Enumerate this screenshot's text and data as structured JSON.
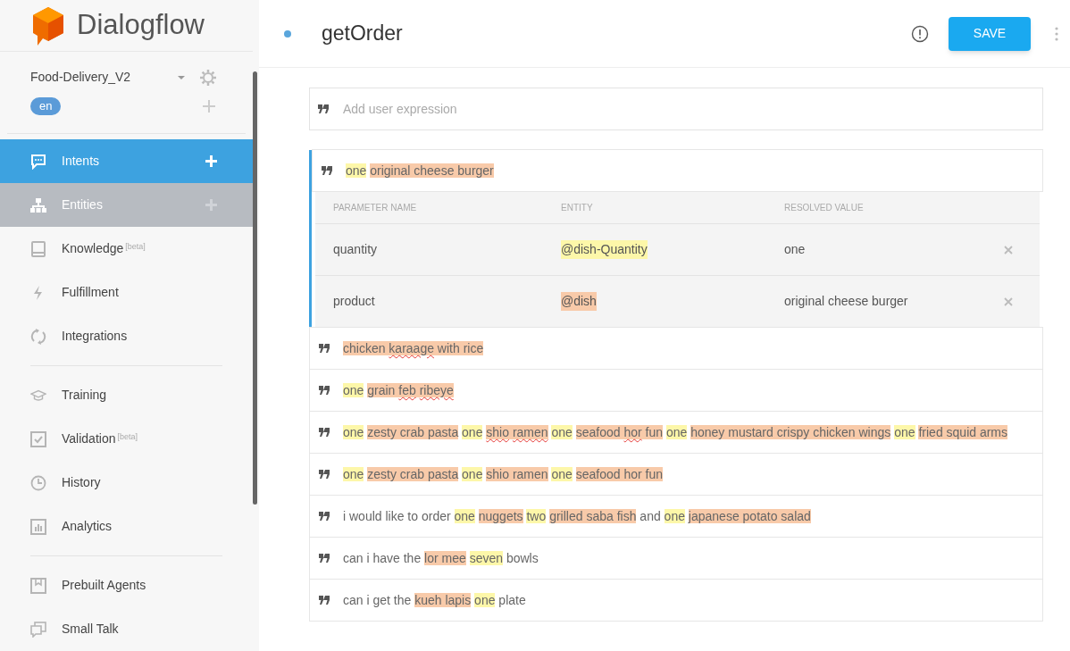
{
  "logo": {
    "name": "Dialogflow"
  },
  "agent": {
    "name": "Food-Delivery_V2",
    "language": "en"
  },
  "sidebar": {
    "sections": [
      {
        "items": [
          {
            "kind": "intents",
            "label": "Intents",
            "selected": true,
            "hovered": false,
            "add_button": true
          },
          {
            "kind": "entities",
            "label": "Entities",
            "selected": false,
            "hovered": true,
            "add_button": true
          },
          {
            "kind": "knowledge",
            "label": "Knowledge",
            "badge": "[beta]",
            "selected": false,
            "hovered": false,
            "add_button": false
          },
          {
            "kind": "fulfillment",
            "label": "Fulfillment",
            "selected": false,
            "hovered": false,
            "add_button": false
          },
          {
            "kind": "integrations",
            "label": "Integrations",
            "selected": false,
            "hovered": false,
            "add_button": false
          }
        ]
      },
      {
        "items": [
          {
            "kind": "training",
            "label": "Training",
            "selected": false,
            "hovered": false,
            "add_button": false
          },
          {
            "kind": "validation",
            "label": "Validation",
            "badge": "[beta]",
            "selected": false,
            "hovered": false,
            "add_button": false
          },
          {
            "kind": "history",
            "label": "History",
            "selected": false,
            "hovered": false,
            "add_button": false
          },
          {
            "kind": "analytics",
            "label": "Analytics",
            "selected": false,
            "hovered": false,
            "add_button": false
          }
        ]
      },
      {
        "items": [
          {
            "kind": "prebuilt",
            "label": "Prebuilt Agents",
            "selected": false,
            "hovered": false,
            "add_button": false
          },
          {
            "kind": "smalltalk",
            "label": "Small Talk",
            "selected": false,
            "hovered": false,
            "add_button": false
          }
        ]
      }
    ]
  },
  "header": {
    "title": "getOrder",
    "save_label": "SAVE"
  },
  "add_expression": {
    "placeholder": "Add user expression"
  },
  "parameter_columns": [
    "PARAMETER NAME",
    "ENTITY",
    "RESOLVED VALUE"
  ],
  "phrases": [
    {
      "expanded": true,
      "parts": [
        {
          "text": "one",
          "kind": "number",
          "misspelled": false
        },
        {
          "text": "original cheese burger",
          "kind": "dish",
          "misspelled": false
        }
      ],
      "parameters": [
        {
          "name": "quantity",
          "entity": "@dish-Quantity",
          "kind": "number",
          "value": "one"
        },
        {
          "name": "product",
          "entity": "@dish",
          "kind": "dish",
          "value": "original cheese burger"
        }
      ]
    },
    {
      "expanded": false,
      "parts": [
        {
          "text": "chicken",
          "kind": "dish",
          "misspelled": false
        },
        {
          "text": "karaage",
          "kind": "dish",
          "misspelled": true
        },
        {
          "text": "with rice",
          "kind": "dish",
          "misspelled": false
        }
      ]
    },
    {
      "expanded": false,
      "parts": [
        {
          "text": "one",
          "kind": "number",
          "misspelled": false
        },
        {
          "text": "grain",
          "kind": "dish",
          "misspelled": false
        },
        {
          "text": "feb",
          "kind": "dish",
          "misspelled": true
        },
        {
          "text": "ribeye",
          "kind": "dish",
          "misspelled": true
        }
      ]
    },
    {
      "expanded": false,
      "parts": [
        {
          "text": "one",
          "kind": "number",
          "misspelled": false
        },
        {
          "text": "zesty crab pasta",
          "kind": "dish",
          "misspelled": false
        },
        {
          "text": "one",
          "kind": "number",
          "misspelled": false
        },
        {
          "text": "shio",
          "kind": "dish",
          "misspelled": true
        },
        {
          "text": "ramen",
          "kind": "dish",
          "misspelled": true
        },
        {
          "text": "one",
          "kind": "number",
          "misspelled": false
        },
        {
          "text": "seafood",
          "kind": "dish",
          "misspelled": false
        },
        {
          "text": "hor",
          "kind": "dish",
          "misspelled": true
        },
        {
          "text": "fun",
          "kind": "dish",
          "misspelled": false
        },
        {
          "text": "one",
          "kind": "number",
          "misspelled": false
        },
        {
          "text": "honey mustard crispy chicken wings",
          "kind": "dish",
          "misspelled": false
        },
        {
          "text": "one",
          "kind": "number",
          "misspelled": false
        },
        {
          "text": "fried squid arms",
          "kind": "dish",
          "misspelled": false
        }
      ]
    },
    {
      "expanded": false,
      "parts": [
        {
          "text": "one",
          "kind": "number",
          "misspelled": false
        },
        {
          "text": "zesty crab pasta",
          "kind": "dish",
          "misspelled": false
        },
        {
          "text": "one",
          "kind": "number",
          "misspelled": false
        },
        {
          "text": "shio ramen",
          "kind": "dish",
          "misspelled": false
        },
        {
          "text": "one",
          "kind": "number",
          "misspelled": false
        },
        {
          "text": "seafood hor fun",
          "kind": "dish",
          "misspelled": false
        }
      ]
    },
    {
      "expanded": false,
      "parts": [
        {
          "text": "i would like to order",
          "kind": "plain",
          "misspelled": false
        },
        {
          "text": "one",
          "kind": "number",
          "misspelled": false
        },
        {
          "text": "nuggets",
          "kind": "dish",
          "misspelled": false
        },
        {
          "text": "two",
          "kind": "number",
          "misspelled": false
        },
        {
          "text": "grilled saba fish",
          "kind": "dish",
          "misspelled": false
        },
        {
          "text": "and",
          "kind": "plain",
          "misspelled": false
        },
        {
          "text": "one",
          "kind": "number",
          "misspelled": false
        },
        {
          "text": "japanese potato salad",
          "kind": "dish",
          "misspelled": false
        }
      ]
    },
    {
      "expanded": false,
      "parts": [
        {
          "text": "can i have the",
          "kind": "plain",
          "misspelled": false
        },
        {
          "text": "lor mee",
          "kind": "dish",
          "misspelled": false
        },
        {
          "text": "seven",
          "kind": "number",
          "misspelled": false
        },
        {
          "text": "bowls",
          "kind": "plain",
          "misspelled": false
        }
      ]
    },
    {
      "expanded": false,
      "parts": [
        {
          "text": "can i get the",
          "kind": "plain",
          "misspelled": false
        },
        {
          "text": "kueh lapis",
          "kind": "dish",
          "misspelled": false
        },
        {
          "text": "one",
          "kind": "number",
          "misspelled": false
        },
        {
          "text": "plate",
          "kind": "plain",
          "misspelled": false
        }
      ]
    }
  ]
}
